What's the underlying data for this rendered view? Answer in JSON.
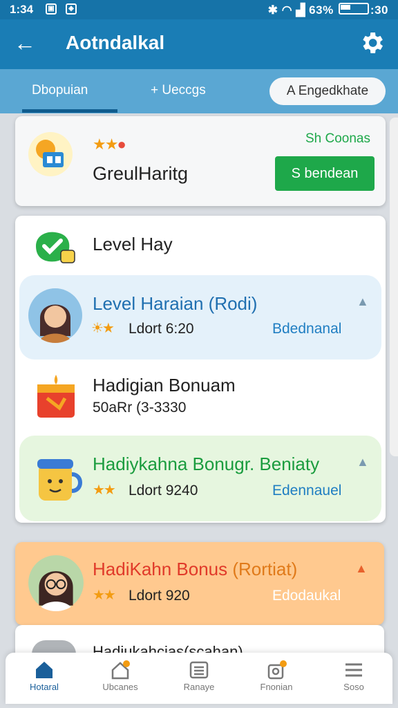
{
  "status_bar": {
    "time": "1:34",
    "right_text_1": "63%",
    "right_text_2": ":30"
  },
  "app_bar": {
    "title": "Aotndalkal",
    "back_icon": "arrow-left-icon",
    "settings_icon": "gear-icon"
  },
  "tabs": {
    "active": "Dbopuian",
    "second": "+ Ueccgs",
    "chip": "A Engedkhate"
  },
  "top_card": {
    "name": "GreulHaritg",
    "coins": "Sh Coonas",
    "button": "S bendean"
  },
  "list": {
    "section_title": "Level Hay",
    "rows": [
      {
        "title": "Level Haraian (Rodi)",
        "sub": "Ldort 6:20",
        "link": "Bdednanal",
        "title_color": "#1f6fb0"
      },
      {
        "title": "Hadigian Bonuam",
        "sub": "50aRr (3-3330",
        "link": "",
        "title_color": "#222222"
      },
      {
        "title": "Hadiykahna Bonugr. Beniaty",
        "sub": "Ldort 9240",
        "link": "Edennauel",
        "title_color": "#1a9c3e"
      }
    ]
  },
  "orange_card": {
    "title_red": "HadiKahn Bonus",
    "title_orange": "(Rortiat)",
    "sub": "Ldort 920",
    "link": "Edodaukal"
  },
  "bottom_peek_text": "Hadiukahcias(scahan)",
  "bottom_nav": [
    {
      "label": "Hotaral",
      "icon": "home-icon",
      "active": true
    },
    {
      "label": "Ubcanes",
      "icon": "house-badge-icon",
      "active": false
    },
    {
      "label": "Ranaye",
      "icon": "list-card-icon",
      "active": false
    },
    {
      "label": "Fnonian",
      "icon": "bag-badge-icon",
      "active": false
    },
    {
      "label": "Soso",
      "icon": "menu-icon",
      "active": false
    }
  ],
  "colors": {
    "appbar": "#1a7db5",
    "tabbar": "#5aa7d3",
    "green": "#1ea84a",
    "orange_card": "#ffc98f",
    "link_blue": "#1f7ec2"
  }
}
